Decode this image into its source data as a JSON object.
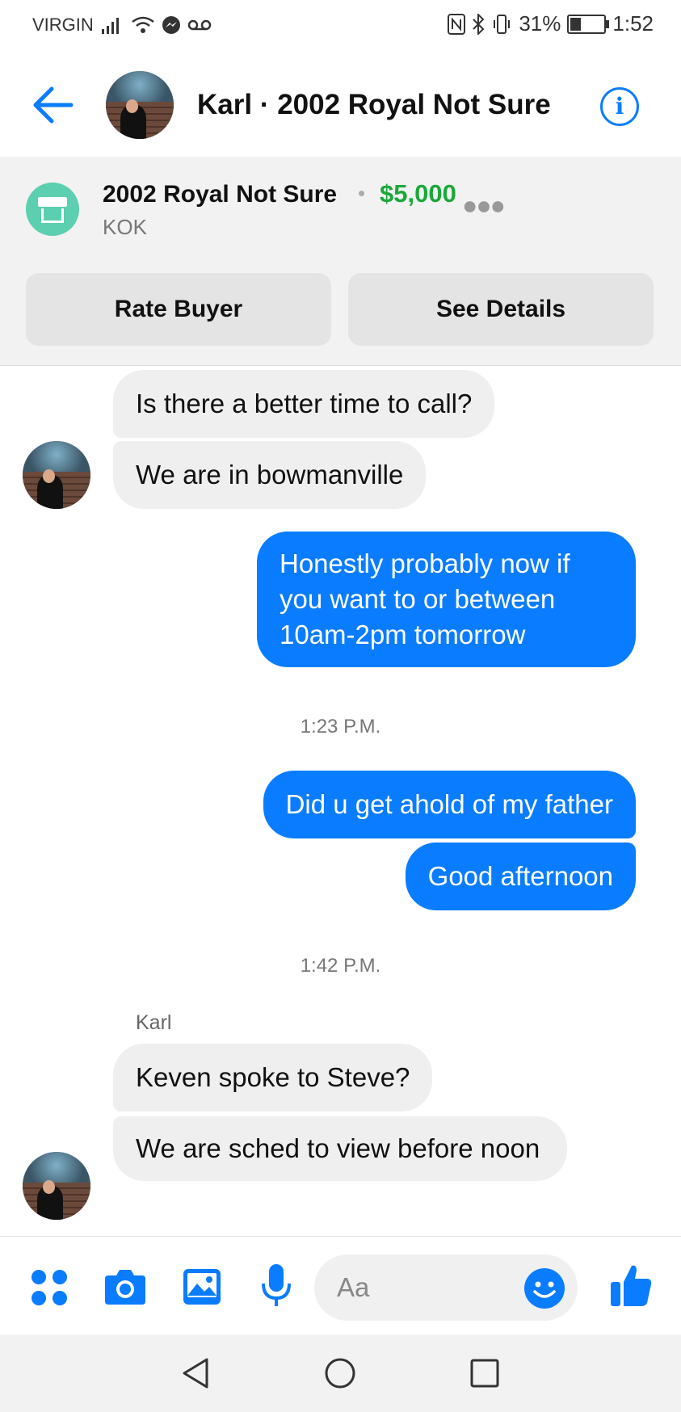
{
  "status_bar": {
    "carrier": "VIRGIN",
    "battery": "31%",
    "battery_level": 0.31,
    "time": "1:52"
  },
  "header": {
    "title": "Karl · 2002 Royal Not Sure",
    "back_icon": "arrow-left-icon",
    "info_icon": "info-icon",
    "accent_color": "#0a7cff"
  },
  "listing": {
    "title": "2002 Royal Not Sure",
    "separator": "•",
    "price": "$5,000",
    "seller": "KOK",
    "more_icon": "more-dots-icon",
    "price_color": "#1aa83a",
    "buttons": {
      "rate": "Rate Buyer",
      "details": "See Details"
    }
  },
  "messages": [
    {
      "from": "them",
      "text": "Is there a better time to call?"
    },
    {
      "from": "them",
      "text": "We are in bowmanville"
    },
    {
      "from": "me",
      "text": "Honestly probably now if you want to or between 10am-2pm tomorrow"
    },
    {
      "type": "timestamp",
      "text": "1:23 P.M."
    },
    {
      "from": "me",
      "text": "Did u get ahold of my father"
    },
    {
      "from": "me",
      "text": "Good afternoon"
    },
    {
      "type": "timestamp",
      "text": "1:42 P.M."
    },
    {
      "type": "sender",
      "text": "Karl"
    },
    {
      "from": "them",
      "text": "Keven spoke to Steve?"
    },
    {
      "from": "them",
      "text": "We are sched to view before noon"
    }
  ],
  "composer": {
    "placeholder": "Aa",
    "icons": [
      "apps-icon",
      "camera-icon",
      "image-icon",
      "microphone-icon",
      "emoji-icon",
      "thumbs-up-icon"
    ]
  },
  "nav": {
    "icons": [
      "back-triangle-icon",
      "home-circle-icon",
      "recents-square-icon"
    ]
  }
}
